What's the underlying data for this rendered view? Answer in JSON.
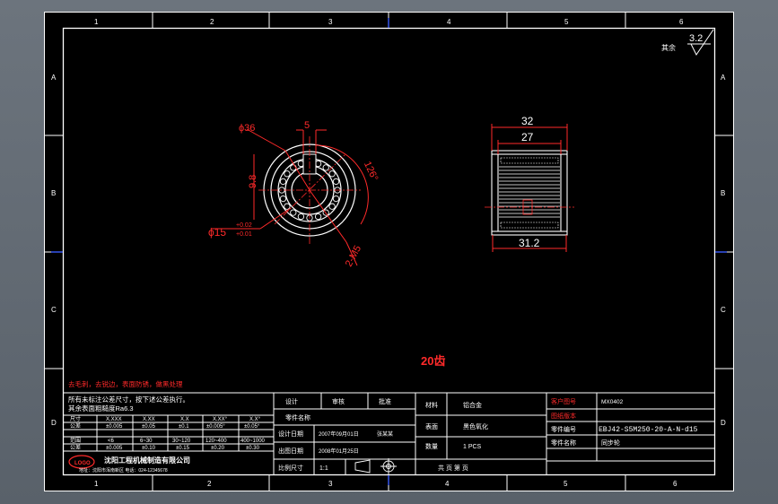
{
  "zone_numbers_top": [
    "1",
    "2",
    "3",
    "4",
    "5",
    "6"
  ],
  "zone_numbers_bottom": [
    "1",
    "2",
    "3",
    "4",
    "5",
    "6"
  ],
  "zone_letters_left": [
    "A",
    "B",
    "C",
    "D"
  ],
  "zone_letters_right": [
    "A",
    "B",
    "C",
    "D"
  ],
  "roughness": {
    "label": "其余",
    "value": "3.2"
  },
  "front_view": {
    "dim_od": "ϕ36",
    "dim_keyway": "5",
    "dim_98": "9.8",
    "dim_angle": "126°",
    "dim_thread": "2-M5",
    "dim_bore": "ϕ15",
    "tol_upper": "+0.02",
    "tol_lower": "+0.01"
  },
  "side_view": {
    "dim_total": "32",
    "dim_inner": "27",
    "dim_bottom": "31.2"
  },
  "teeth_note": "20齿",
  "red_note": "去毛刺，去锐边，表面防锈，做黑处理",
  "notes": [
    "所有未标注公差尺寸，按下述公差执行。",
    "其余表面粗糙度Ra6.3"
  ],
  "tol_table": {
    "row_labels": [
      "尺寸",
      "公差",
      "范围",
      "公差"
    ],
    "columns": [
      [
        "X.XXX",
        "±0.005",
        "<6",
        "±0.005"
      ],
      [
        "X.XX",
        "±0.05",
        "6~30",
        "±0.10"
      ],
      [
        "X.X",
        "±0.1",
        "30~120",
        "±0.15"
      ],
      [
        "X.XX°",
        "±0.005°",
        "120~400",
        "±0.20"
      ],
      [
        "X.X°",
        "±0.05°",
        "400~1000",
        "±0.30"
      ]
    ]
  },
  "company": "沈阳工程机械制造有限公司",
  "company_sub": "地址：沈阳市浑南新区  电话：024-12345678",
  "company_logo": "LOGO",
  "title_block": {
    "design": "设计",
    "review": "审核",
    "approve": "批准",
    "part_name_label": "零件名称",
    "design_date": "设计日期",
    "design_date_val": "2007年09月01日",
    "designer": "张某某",
    "print_date": "出图日期",
    "print_date_val": "2008年01月25日",
    "scale_label": "比例尺寸",
    "scale_val": "1:1",
    "material_label": "材料",
    "material_val": "铝合金",
    "surface_label": "表面",
    "surface_val": "黑色氧化",
    "qty_label": "数量",
    "qty_val": "1 PCS",
    "sheet_label": "共  页  第  页",
    "drawing_no_label": "客户图号",
    "drawing_no_val": "MX0402",
    "revision_label": "图纸版本",
    "part_no_label": "零件编号",
    "part_no_val": "EBJ42-S5M250-20-A-N-d15",
    "part_desc_label": "零件名称",
    "part_desc_val": "同步轮"
  }
}
